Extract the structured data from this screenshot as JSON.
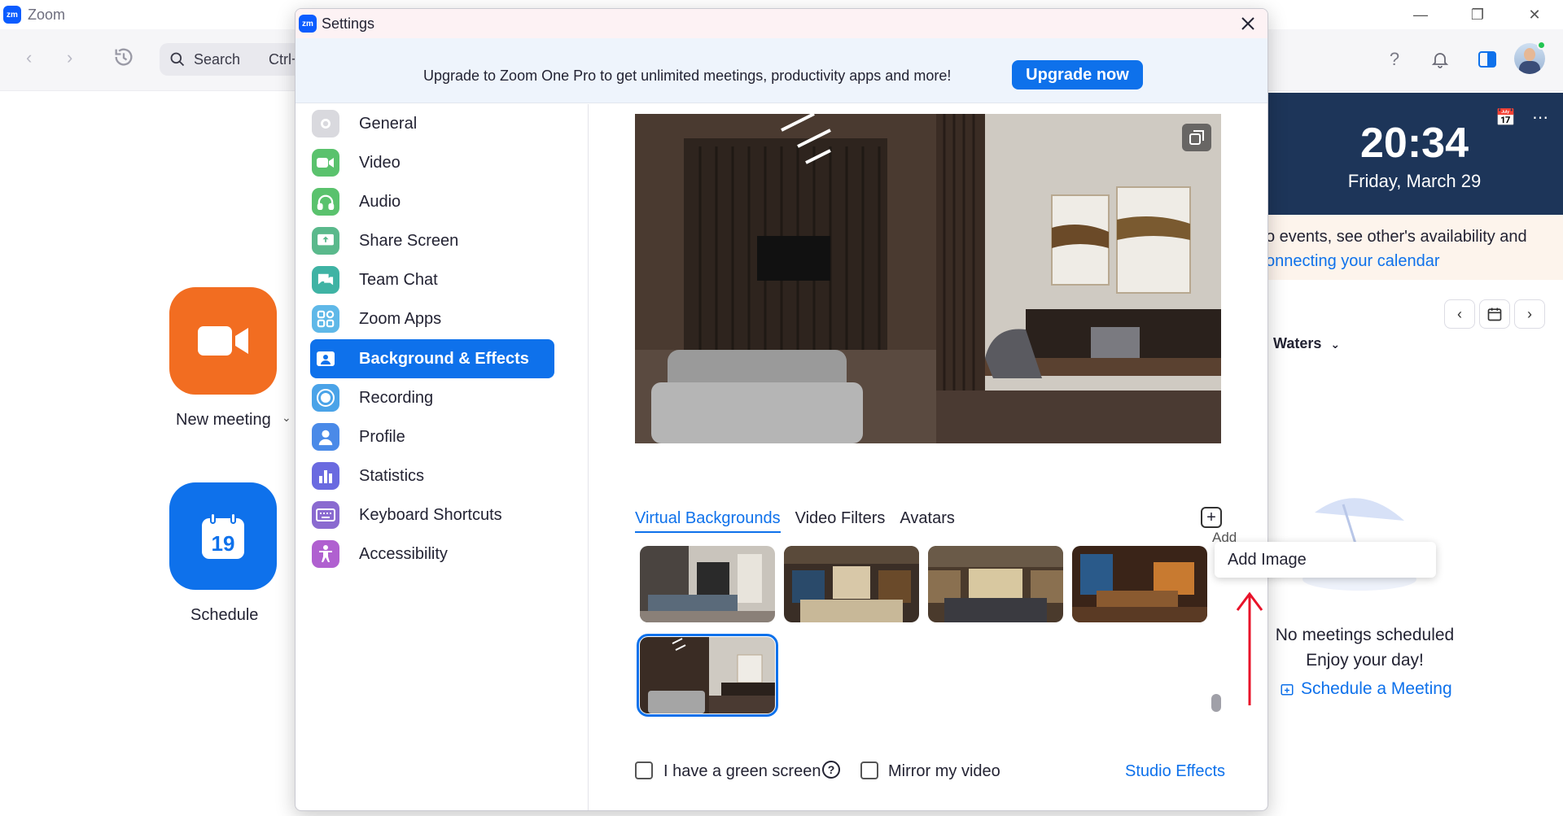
{
  "main": {
    "logo": "zm",
    "title": "Zoom",
    "search": {
      "placeholder": "Search",
      "shortcut": "Ctrl+"
    },
    "tiles": [
      {
        "label": "New meeting"
      },
      {
        "label": "Schedule",
        "date": "19"
      }
    ],
    "clock": {
      "time": "20:34",
      "date": "Friday, March 29"
    },
    "notice": {
      "line1": "o events, see other's availability and",
      "link": "onnecting your calendar"
    },
    "calendar_user": "Waters",
    "empty": {
      "title": "No meetings scheduled",
      "subtitle": "Enjoy your day!",
      "schedule_link": "Schedule a Meeting"
    }
  },
  "settings": {
    "logo": "zm",
    "title": "Settings",
    "upgrade": {
      "text": "Upgrade to Zoom One Pro to get unlimited meetings, productivity apps and more!",
      "button": "Upgrade now"
    },
    "sidebar": [
      {
        "label": "General",
        "icon": "gear-icon",
        "color": "#d9d9de"
      },
      {
        "label": "Video",
        "icon": "video-icon",
        "color": "#5ac26d"
      },
      {
        "label": "Audio",
        "icon": "headphones-icon",
        "color": "#5ac26d"
      },
      {
        "label": "Share Screen",
        "icon": "share-screen-icon",
        "color": "#5ab98c"
      },
      {
        "label": "Team Chat",
        "icon": "chat-icon",
        "color": "#3fb3a4"
      },
      {
        "label": "Zoom Apps",
        "icon": "apps-icon",
        "color": "#5fb8e8"
      },
      {
        "label": "Background & Effects",
        "icon": "background-icon",
        "color": "#ffffff",
        "active": true
      },
      {
        "label": "Recording",
        "icon": "record-icon",
        "color": "#4aa3e8"
      },
      {
        "label": "Profile",
        "icon": "profile-icon",
        "color": "#4a8ae8"
      },
      {
        "label": "Statistics",
        "icon": "statistics-icon",
        "color": "#6a6ae0"
      },
      {
        "label": "Keyboard Shortcuts",
        "icon": "keyboard-icon",
        "color": "#8a6ad0"
      },
      {
        "label": "Accessibility",
        "icon": "accessibility-icon",
        "color": "#b060d0"
      }
    ],
    "tabs": [
      "Virtual Backgrounds",
      "Video Filters",
      "Avatars"
    ],
    "active_tab": "Virtual Backgrounds",
    "add_image_tooltip": "Add Image",
    "add_image_menu": "Add Image",
    "green_screen": "I have a green screen",
    "mirror_video": "Mirror my video",
    "studio_effects": "Studio Effects"
  },
  "colors": {
    "accent": "#0e71eb",
    "orange_tile": "#f26d21",
    "clock_bg": "#1d3559",
    "annotation": "#e8132a"
  }
}
